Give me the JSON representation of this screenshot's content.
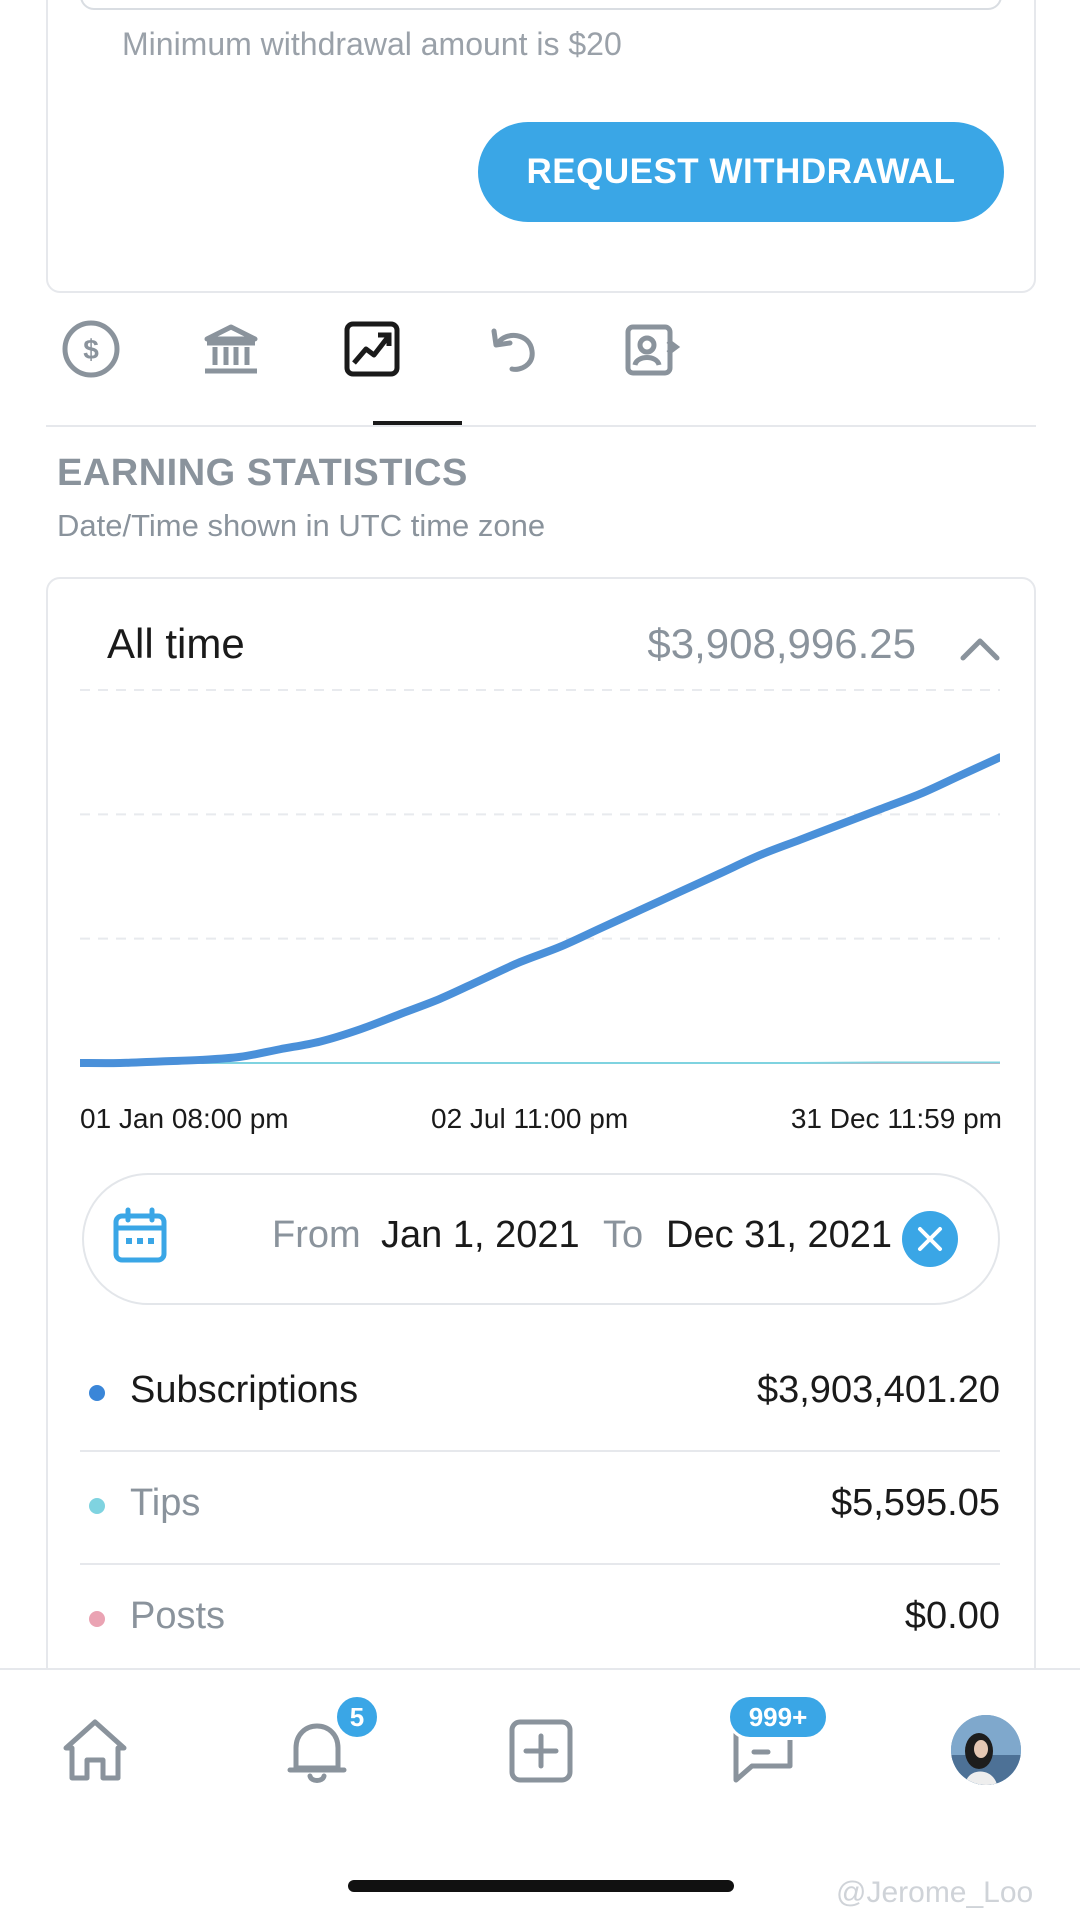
{
  "withdrawal": {
    "min_note": "Minimum withdrawal amount is $20",
    "request_button": "REQUEST WITHDRAWAL"
  },
  "tabs": [
    {
      "icon": "dollar-circle-icon",
      "active": false
    },
    {
      "icon": "bank-icon",
      "active": false
    },
    {
      "icon": "chart-trend-icon",
      "active": true
    },
    {
      "icon": "undo-icon",
      "active": false
    },
    {
      "icon": "user-statement-icon",
      "active": false
    }
  ],
  "section": {
    "title": "EARNING STATISTICS",
    "subtitle": "Date/Time shown in UTC time zone"
  },
  "stats": {
    "period_label": "All time",
    "period_total": "$3,908,996.25"
  },
  "chart_data": {
    "type": "line",
    "x_tick_labels": [
      "01 Jan 08:00 pm",
      "02 Jul 11:00 pm",
      "31 Dec 11:59 pm"
    ],
    "grid": true,
    "series": [
      {
        "key": "subscriptions",
        "color": "#4a90d9",
        "values": [
          0,
          0,
          0.5,
          1,
          2,
          4.5,
          7,
          11,
          16,
          21,
          27,
          33,
          38,
          44,
          50,
          56,
          62,
          68,
          73,
          78,
          83,
          88,
          94,
          100
        ]
      },
      {
        "key": "tips",
        "color": "#7fd3e0",
        "values": [
          0,
          0,
          0,
          0,
          0,
          0,
          0,
          0,
          0,
          0,
          0,
          0,
          0,
          0,
          0,
          0,
          0,
          0,
          0,
          0.1,
          0.15,
          0.15,
          0.15,
          0.15
        ]
      },
      {
        "key": "posts",
        "color": "#e8a0b0",
        "values": [
          0,
          0,
          0,
          0,
          0,
          0,
          0,
          0,
          0,
          0,
          0,
          0,
          0,
          0,
          0,
          0,
          0,
          0,
          0,
          0,
          0,
          0,
          0,
          0
        ]
      }
    ]
  },
  "date_range": {
    "from_label": "From",
    "from": "Jan 1, 2021",
    "to_label": "To",
    "to": "Dec 31, 2021",
    "calendar_icon": "calendar-icon",
    "clear_icon": "close-icon"
  },
  "breakdown": [
    {
      "label": "Subscriptions",
      "value": "$3,903,401.20",
      "dot_color": "#3a86d8",
      "label_color": "#1a1a1a"
    },
    {
      "label": "Tips",
      "value": "$5,595.05",
      "dot_color": "#7fd3e0",
      "label_color": "#8a939c"
    },
    {
      "label": "Posts",
      "value": "$0.00",
      "dot_color": "#eaa3b3",
      "label_color": "#8a939c"
    }
  ],
  "bottom_nav": {
    "home_icon": "home-icon",
    "notifications_icon": "bell-icon",
    "notifications_count": "5",
    "create_icon": "plus-square-icon",
    "messages_icon": "chat-icon",
    "messages_count": "999+",
    "profile_icon": "avatar"
  },
  "watermark": "@Jerome_Loo",
  "colors": {
    "accent": "#3aa6e6",
    "muted": "#8a939c"
  }
}
